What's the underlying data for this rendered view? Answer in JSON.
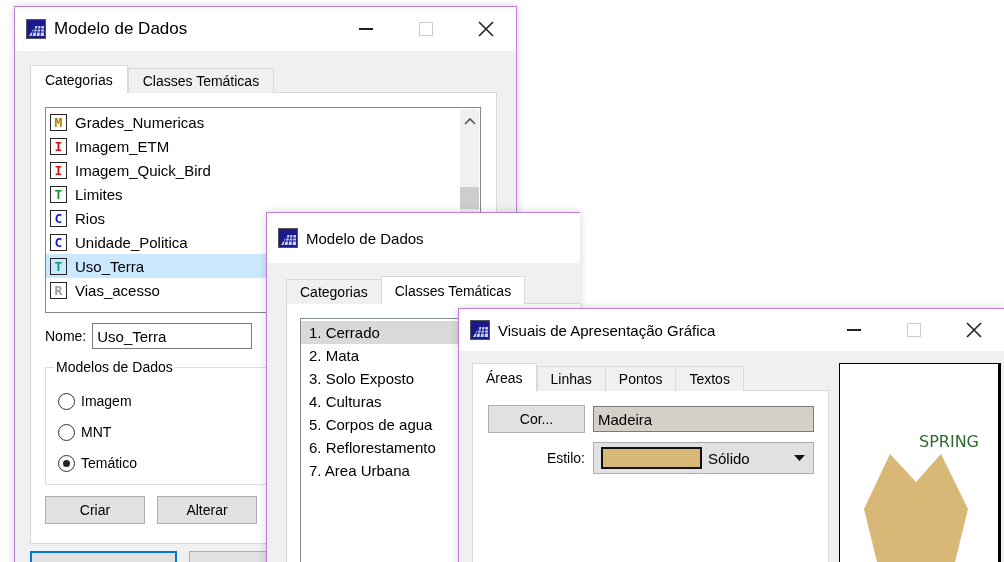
{
  "main_window": {
    "title": "Modelo de Dados",
    "tabs": [
      {
        "label": "Categorias",
        "selected": true
      },
      {
        "label": "Classes Temáticas",
        "selected": false
      }
    ],
    "categories": [
      {
        "letter": "M",
        "color": "#b07a00",
        "label": "Grades_Numericas",
        "selected": false
      },
      {
        "letter": "I",
        "color": "#e01010",
        "label": "Imagem_ETM",
        "selected": false
      },
      {
        "letter": "I",
        "color": "#e01010",
        "label": "Imagem_Quick_Bird",
        "selected": false
      },
      {
        "letter": "T",
        "color": "#129a2a",
        "label": "Limites",
        "selected": false
      },
      {
        "letter": "C",
        "color": "#1414e0",
        "label": "Rios",
        "selected": false
      },
      {
        "letter": "C",
        "color": "#1414e0",
        "label": "Unidade_Politica",
        "selected": false
      },
      {
        "letter": "T",
        "color": "#129a7a",
        "label": "Uso_Terra",
        "selected": true
      },
      {
        "letter": "R",
        "color": "#9a9a9a",
        "label": "Vias_acesso",
        "selected": false
      }
    ],
    "name_label": "Nome:",
    "name_value": "Uso_Terra",
    "group": {
      "title": "Modelos de Dados",
      "options": [
        {
          "label": "Imagem",
          "selected": false
        },
        {
          "label": "MNT",
          "selected": false
        },
        {
          "label": "Temático",
          "selected": true
        }
      ]
    },
    "buttons": [
      "Criar",
      "Alterar"
    ]
  },
  "classes_window": {
    "title": "Modelo de Dados",
    "tabs": [
      {
        "label": "Categorias",
        "selected": false
      },
      {
        "label": "Classes Temáticas",
        "selected": true
      }
    ],
    "classes": [
      {
        "label": "1. Cerrado",
        "selected": true
      },
      {
        "label": "2. Mata",
        "selected": false
      },
      {
        "label": "3. Solo Exposto",
        "selected": false
      },
      {
        "label": "4. Culturas",
        "selected": false
      },
      {
        "label": "5. Corpos de agua",
        "selected": false
      },
      {
        "label": "6. Reflorestamento",
        "selected": false
      },
      {
        "label": "7. Area Urbana",
        "selected": false
      }
    ]
  },
  "visuals_window": {
    "title": "Visuais de Apresentação Gráfica",
    "tabs": [
      {
        "label": "Áreas",
        "selected": true
      },
      {
        "label": "Linhas",
        "selected": false
      },
      {
        "label": "Pontos",
        "selected": false
      },
      {
        "label": "Textos",
        "selected": false
      }
    ],
    "color_button": "Cor...",
    "color_name": "Madeira",
    "style_label": "Estilo:",
    "style_value": "Sólido",
    "color": "#d9b776",
    "preview_text": "SPRING"
  }
}
